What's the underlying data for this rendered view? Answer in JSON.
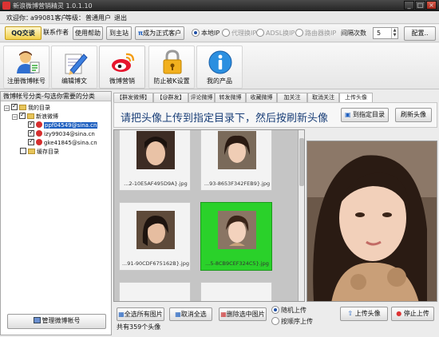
{
  "window": {
    "title": "新浪微博营销精灵 1.0.1.10",
    "btn_min": "_",
    "btn_max": "□",
    "btn_close": "×"
  },
  "status": {
    "welcome": "欢迎你：",
    "user": "a99081客户",
    "level_label": "等级：",
    "level": "普通用户",
    "logout": "退出"
  },
  "toolbar": {
    "qq": "QQ交谈",
    "contact_author": "联系作者",
    "help": "使用帮助",
    "home": "到主站",
    "upgrade": "成为正式客户",
    "radios": [
      {
        "label": "本地IP",
        "checked": true,
        "enabled": true
      },
      {
        "label": "代理换IP",
        "checked": false,
        "enabled": false
      },
      {
        "label": "ADSL换IP",
        "checked": false,
        "enabled": false
      },
      {
        "label": "路由器换IP",
        "checked": false,
        "enabled": false
      }
    ],
    "interval_label": "间隔次数",
    "interval_value": "5",
    "config": "配置.."
  },
  "tools": [
    {
      "label": "注册微博帐号",
      "icon": "user-register-icon"
    },
    {
      "label": "编辑博文",
      "icon": "edit-post-icon"
    },
    {
      "label": "微博营销",
      "icon": "weibo-logo-icon"
    },
    {
      "label": "防止被K设置",
      "icon": "lock-icon"
    },
    {
      "label": "我的产品",
      "icon": "info-icon"
    }
  ],
  "left": {
    "header": "微博帐号分类-勾选你需要的分类",
    "tree": {
      "root": "我的目录",
      "group": "新浪微博",
      "accounts": [
        "ppf04549@sina.cn",
        "izy99034@sina.cn",
        "gke41845@sina.cn"
      ],
      "cache": "缓存目录"
    },
    "manage": "管理微博帐号"
  },
  "tabs": [
    "【群发微博】",
    "【@群发】",
    "评论微博",
    "转发微博",
    "收藏微博",
    "加关注",
    "取消关注",
    "上传头像"
  ],
  "banner": {
    "message": "请把头像上传到指定目录下，然后按刷新头像",
    "open_dir": "到指定目录",
    "refresh": "刷新头像"
  },
  "thumbs": [
    {
      "name": "...2-10E5AF495D9A}.jpg",
      "selected": false
    },
    {
      "name": "...93-8653F342FEB9}.jpg",
      "selected": false
    },
    {
      "name": "...91-90CDF675162B}.jpg",
      "selected": false
    },
    {
      "name": "...5-8CB9CEF324C5}.jpg",
      "selected": true
    }
  ],
  "controls": {
    "select_all": "全选所有图片",
    "cancel_all": "取消全选",
    "delete_selected": "删除选中图片",
    "random_upload": "随机上传",
    "ordered_upload": "按顺序上传",
    "upload": "上传头像",
    "stop": "停止上传",
    "count_text": "共有359个头像"
  },
  "colors": {
    "accent": "#1f60c0",
    "selected_thumb": "#2ad12a",
    "title_bg": "#2b2b2b"
  }
}
